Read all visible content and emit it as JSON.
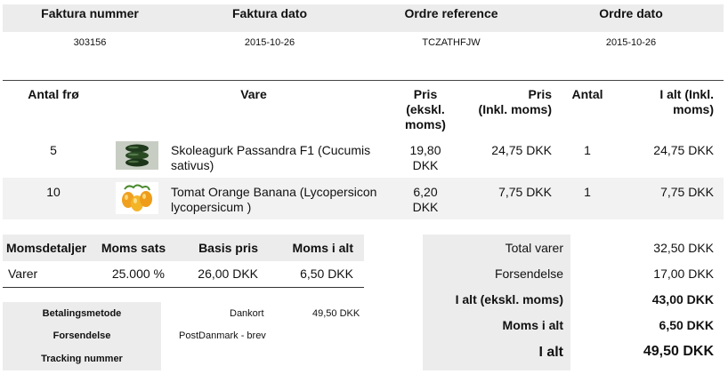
{
  "invoice_header": {
    "labels": [
      "Faktura nummer",
      "Faktura dato",
      "Ordre reference",
      "Ordre dato"
    ],
    "values": [
      "303156",
      "2015-10-26",
      "TCZATHFJW",
      "2015-10-26"
    ]
  },
  "items_table": {
    "headers": {
      "qty": "Antal frø",
      "product": "Vare",
      "price_excl_line1": "Pris",
      "price_excl_line2": "(ekskl.",
      "price_excl_line3": "moms)",
      "price_incl_line1": "Pris",
      "price_incl_line2": "(Inkl. moms)",
      "count": "Antal",
      "total_line1": "I alt (Inkl.",
      "total_line2": "moms)"
    },
    "rows": [
      {
        "qty": "5",
        "image_icon": "cucumber-image",
        "name_line1": "Skoleagurk Passandra F1 (Cucumis",
        "name_line2": "sativus)",
        "price_excl_line1": "19,80",
        "price_excl_line2": "DKK",
        "price_incl": "24,75 DKK",
        "count": "1",
        "total": "24,75 DKK"
      },
      {
        "qty": "10",
        "image_icon": "orange-tomato-image",
        "name_line1": "Tomat Orange Banana (Lycopersicon",
        "name_line2": "lycopersicum )",
        "price_excl_line1": "6,20",
        "price_excl_line2": "DKK",
        "price_incl": "7,75 DKK",
        "count": "1",
        "total": "7,75 DKK"
      }
    ]
  },
  "moms": {
    "headers": [
      "Momsdetaljer",
      "Moms sats",
      "Basis pris",
      "Moms i alt"
    ],
    "row": [
      "Varer",
      "25.000 %",
      "26,00 DKK",
      "6,50 DKK"
    ]
  },
  "payment": {
    "method_label": "Betalingsmetode",
    "method_value": "Dankort",
    "method_amount": "49,50 DKK",
    "shipping_label": "Forsendelse",
    "shipping_value": "PostDanmark - brev",
    "tracking_label": "Tracking nummer"
  },
  "totals": {
    "total_items_label": "Total varer",
    "total_items_value": "32,50 DKK",
    "shipping_label": "Forsendelse",
    "shipping_value": "17,00 DKK",
    "excl_label": "I alt (ekskl. moms)",
    "excl_value": "43,00 DKK",
    "vat_label": "Moms i alt",
    "vat_value": "6,50 DKK",
    "grand_label": "I alt",
    "grand_value": "49,50 DKK"
  },
  "colors": {
    "header_bg": "#ececec",
    "stripe_bg": "#f2f2f2",
    "text": "#111111"
  }
}
